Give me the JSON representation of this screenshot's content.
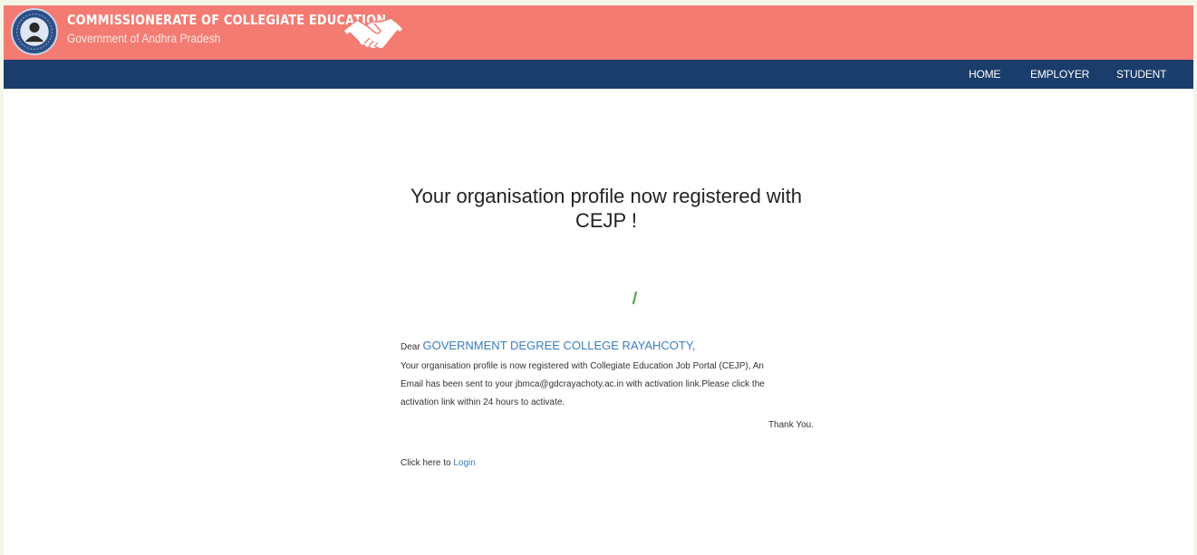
{
  "header": {
    "title": "COMMISSIONERATE OF COLLEGIATE EDUCATION",
    "subtitle": "Government of Andhra Pradesh"
  },
  "nav": {
    "items": [
      {
        "label": "HOME"
      },
      {
        "label": "EMPLOYER"
      },
      {
        "label": "STUDENT"
      }
    ]
  },
  "main": {
    "headline_line1": "Your organisation profile now registered with",
    "headline_line2": "CEJP !",
    "dear": "Dear",
    "org_name": "GOVERNMENT DEGREE COLLEGE RAYAHCOTY,",
    "message_line1": "Your organisation profile is now registered with Collegiate Education Job Portal (CEJP), An",
    "message_line2": "Email has been sent to your jbmca@gdcrayachoty.ac.in with activation link.Please click the",
    "message_line3": "activation link within 24 hours to activate.",
    "thanks": "Thank You.",
    "login_prefix": "Click here to",
    "login_link": "Login"
  },
  "colors": {
    "header_bg": "#f47b72",
    "nav_bg": "#1b3d6b",
    "link": "#3b7dbf",
    "loader": "#6aa84f"
  },
  "icons": [
    "emblem-logo-icon",
    "handshake-icon",
    "loading-spinner-icon"
  ]
}
